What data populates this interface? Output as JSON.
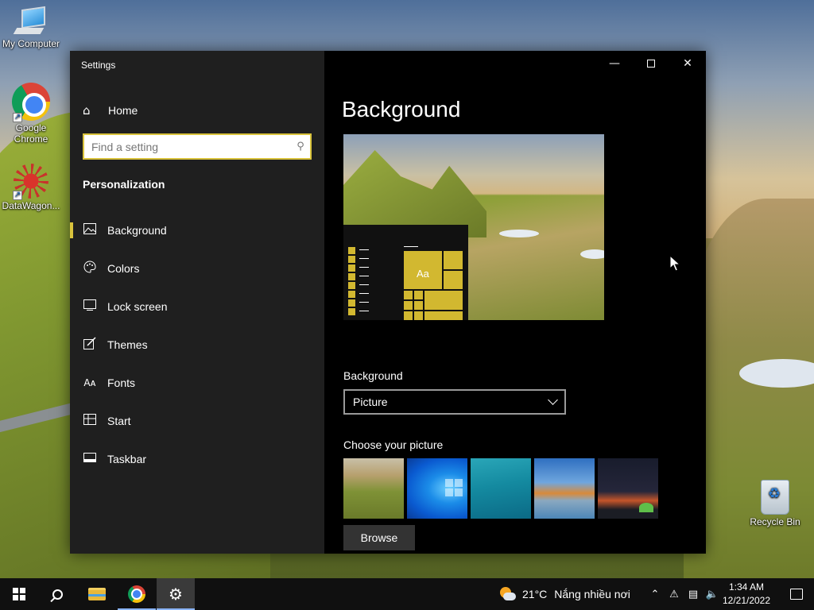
{
  "desktop": {
    "icons": [
      {
        "label": "My Computer"
      },
      {
        "label": "Google Chrome"
      },
      {
        "label": "DataWagon..."
      },
      {
        "label": "Recycle Bin"
      }
    ]
  },
  "window": {
    "title": "Settings",
    "controls": {
      "minimize_icon": "minimize-icon",
      "maximize_icon": "maximize-icon",
      "close_icon": "close-icon"
    }
  },
  "sidebar": {
    "home_label": "Home",
    "search_placeholder": "Find a setting",
    "section": "Personalization",
    "items": [
      {
        "label": "Background",
        "icon": "picture-icon",
        "active": true
      },
      {
        "label": "Colors",
        "icon": "palette-icon",
        "active": false
      },
      {
        "label": "Lock screen",
        "icon": "lock-screen-icon",
        "active": false
      },
      {
        "label": "Themes",
        "icon": "brush-icon",
        "active": false
      },
      {
        "label": "Fonts",
        "icon": "font-icon",
        "active": false
      },
      {
        "label": "Start",
        "icon": "start-icon",
        "active": false
      },
      {
        "label": "Taskbar",
        "icon": "taskbar-icon",
        "active": false
      }
    ]
  },
  "content": {
    "title": "Background",
    "preview": {
      "sample_text": "Aa",
      "accent": "#d2b830"
    },
    "background_label": "Background",
    "background_value": "Picture",
    "choose_label": "Choose your picture",
    "browse_label": "Browse"
  },
  "taskbar": {
    "weather_temp": "21°C",
    "weather_text": "Nắng nhiều nơi",
    "time": "1:34 AM",
    "date": "12/21/2022"
  },
  "colors": {
    "accent": "#d9c33c",
    "sidebar_bg": "#1f1f1f",
    "content_bg": "#000000",
    "taskbar_bg": "#101010"
  }
}
